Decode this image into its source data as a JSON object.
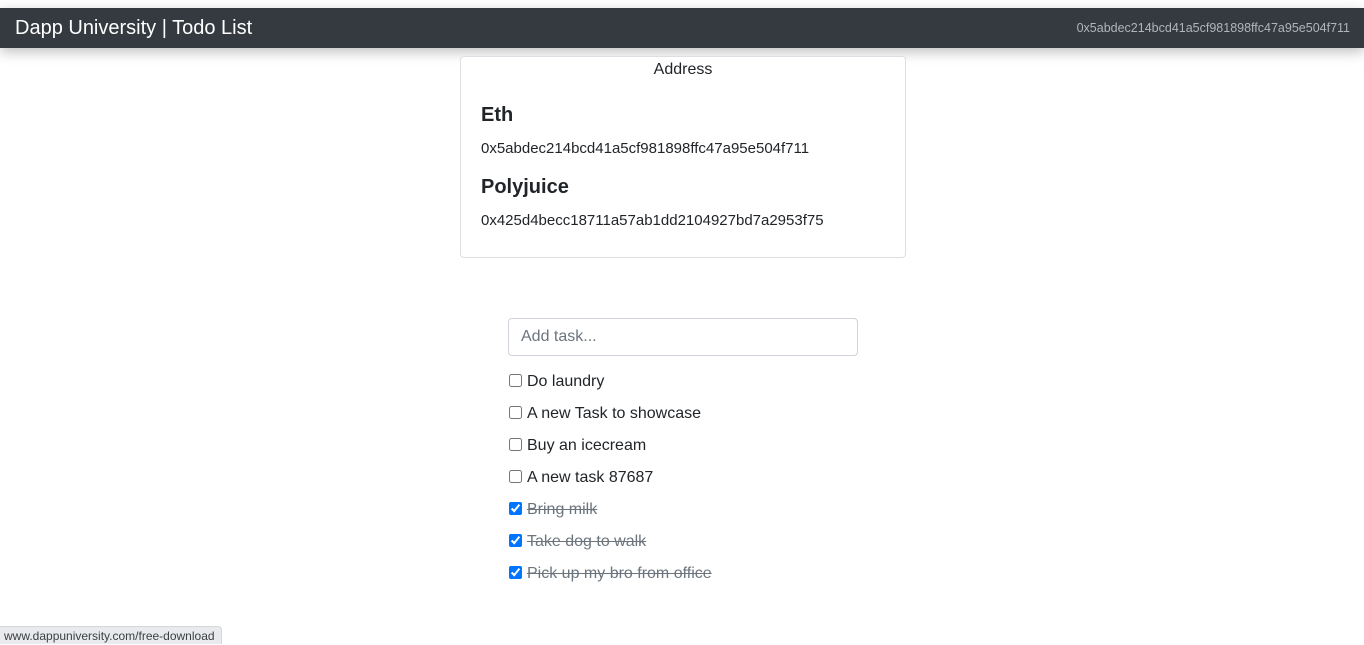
{
  "navbar": {
    "brand": "Dapp University | Todo List",
    "account_address": "0x5abdec214bcd41a5cf981898ffc47a95e504f711"
  },
  "address_card": {
    "header": "Address",
    "eth_title": "Eth",
    "eth_address": "0x5abdec214bcd41a5cf981898ffc47a95e504f711",
    "polyjuice_title": "Polyjuice",
    "polyjuice_address": "0x425d4becc18711a57ab1dd2104927bd7a2953f75"
  },
  "todo": {
    "input_placeholder": "Add task...",
    "input_value": "",
    "tasks": [
      {
        "text": "Do laundry",
        "completed": false
      },
      {
        "text": "A new Task to showcase",
        "completed": false
      },
      {
        "text": "Buy an icecream",
        "completed": false
      },
      {
        "text": "A new task 87687",
        "completed": false
      },
      {
        "text": "Bring milk",
        "completed": true
      },
      {
        "text": "Take dog to walk",
        "completed": true
      },
      {
        "text": "Pick up my bro from office",
        "completed": true
      }
    ]
  },
  "status_bar": {
    "url": "www.dappuniversity.com/free-download"
  }
}
